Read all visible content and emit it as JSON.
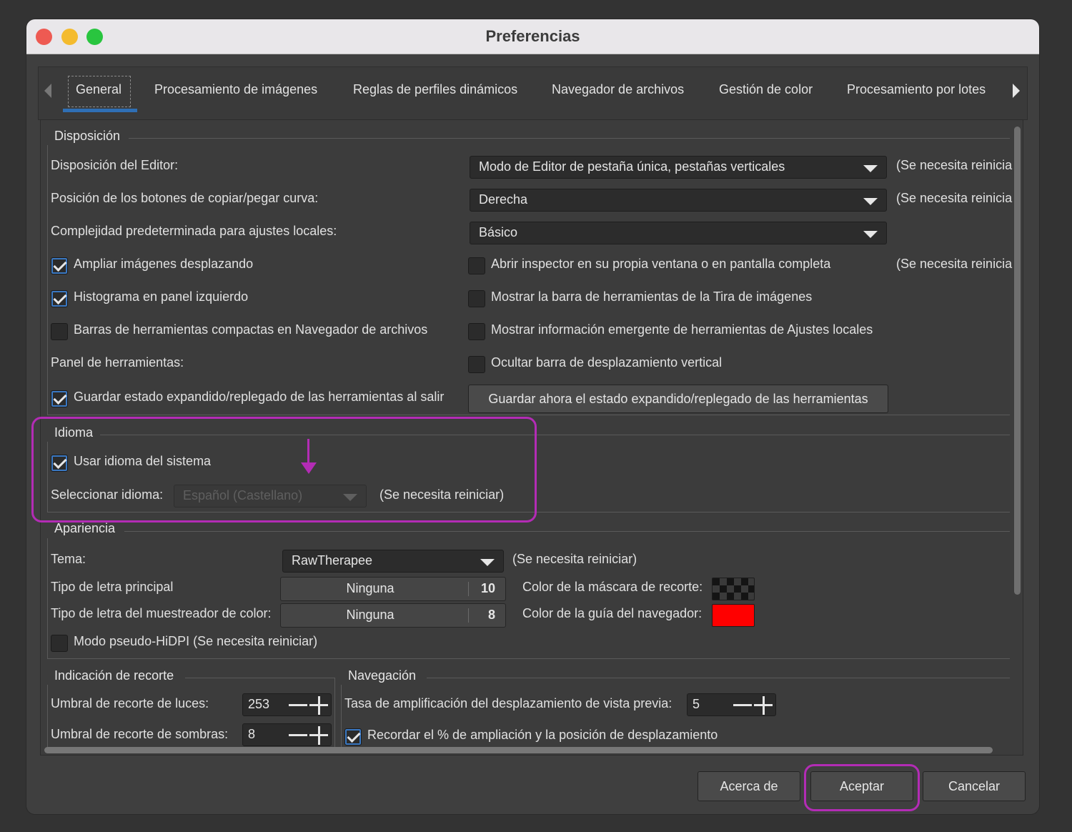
{
  "window": {
    "title": "Preferencias"
  },
  "tabs": [
    {
      "label": "General",
      "selected": true
    },
    {
      "label": "Procesamiento de imágenes"
    },
    {
      "label": "Reglas de perfiles dinámicos"
    },
    {
      "label": "Navegador de archivos"
    },
    {
      "label": "Gestión de color"
    },
    {
      "label": "Procesamiento por lotes"
    }
  ],
  "layout_section": {
    "title": "Disposición",
    "editor_layout_label": "Disposición del Editor:",
    "editor_layout_value": "Modo de Editor de pestaña única, pestañas verticales",
    "editor_layout_note": "(Se necesita reinicia",
    "curve_buttons_label": "Posición de los botones de copiar/pegar curva:",
    "curve_buttons_value": "Derecha",
    "curve_buttons_note": "(Se necesita reinicia",
    "local_complexity_label": "Complejidad predeterminada para ajustes locales:",
    "local_complexity_value": "Básico",
    "zoom_scroll_label": "Ampliar imágenes desplazando",
    "zoom_scroll_checked": true,
    "inspector_window_label": "Abrir inspector en su propia ventana o en pantalla completa",
    "inspector_window_checked": false,
    "inspector_window_note": "(Se necesita reinicia",
    "histogram_left_label": "Histograma en panel izquierdo",
    "histogram_left_checked": true,
    "filmstrip_toolbar_label": "Mostrar la barra de herramientas de la Tira de imágenes",
    "filmstrip_toolbar_checked": false,
    "compact_toolbars_label": "Barras de herramientas compactas en Navegador de archivos",
    "compact_toolbars_checked": false,
    "local_tooltips_label": "Mostrar información emergente de herramientas de Ajustes locales",
    "local_tooltips_checked": false,
    "tool_panel_label": "Panel de herramientas:",
    "hide_vscroll_label": "Ocultar barra de desplazamiento vertical",
    "hide_vscroll_checked": false,
    "save_expanded_label": "Guardar estado expandido/replegado de las herramientas al salir",
    "save_expanded_checked": true,
    "save_now_button": "Guardar ahora el estado expandido/replegado de las herramientas"
  },
  "language_section": {
    "title": "Idioma",
    "use_system_label": "Usar idioma del sistema",
    "use_system_checked": true,
    "select_label": "Seleccionar idioma:",
    "select_value": "Español (Castellano)",
    "note": "(Se necesita reiniciar)"
  },
  "appearance_section": {
    "title": "Apariencia",
    "theme_label": "Tema:",
    "theme_value": "RawTherapee",
    "theme_note": "(Se necesita reiniciar)",
    "main_font_label": "Tipo de letra principal",
    "main_font_name": "Ninguna",
    "main_font_size": "10",
    "picker_font_label": "Tipo de letra del muestreador de color:",
    "picker_font_name": "Ninguna",
    "picker_font_size": "8",
    "crop_mask_color_label": "Color de la máscara de recorte:",
    "nav_guide_color_label": "Color de la guía del navegador:",
    "nav_guide_color": "#ff0000",
    "pseudo_hidpi_label": "Modo pseudo-HiDPI (Se necesita reiniciar)",
    "pseudo_hidpi_checked": false
  },
  "clip_section": {
    "title": "Indicación de recorte",
    "highlights_label": "Umbral de recorte de luces:",
    "highlights_value": "253",
    "shadows_label": "Umbral de recorte de sombras:",
    "shadows_value": "8"
  },
  "nav_section": {
    "title": "Navegación",
    "scroll_rate_label": "Tasa de amplificación del desplazamiento de vista previa:",
    "scroll_rate_value": "5",
    "remember_zoom_label": "Recordar el % de ampliación y la posición de desplazamiento",
    "remember_zoom_checked": true
  },
  "footer": {
    "about_button": "Acerca de",
    "ok_button": "Aceptar",
    "cancel_button": "Cancelar"
  },
  "colors": {
    "annotation": "#b32cb5",
    "accent": "#2f6fb5"
  }
}
